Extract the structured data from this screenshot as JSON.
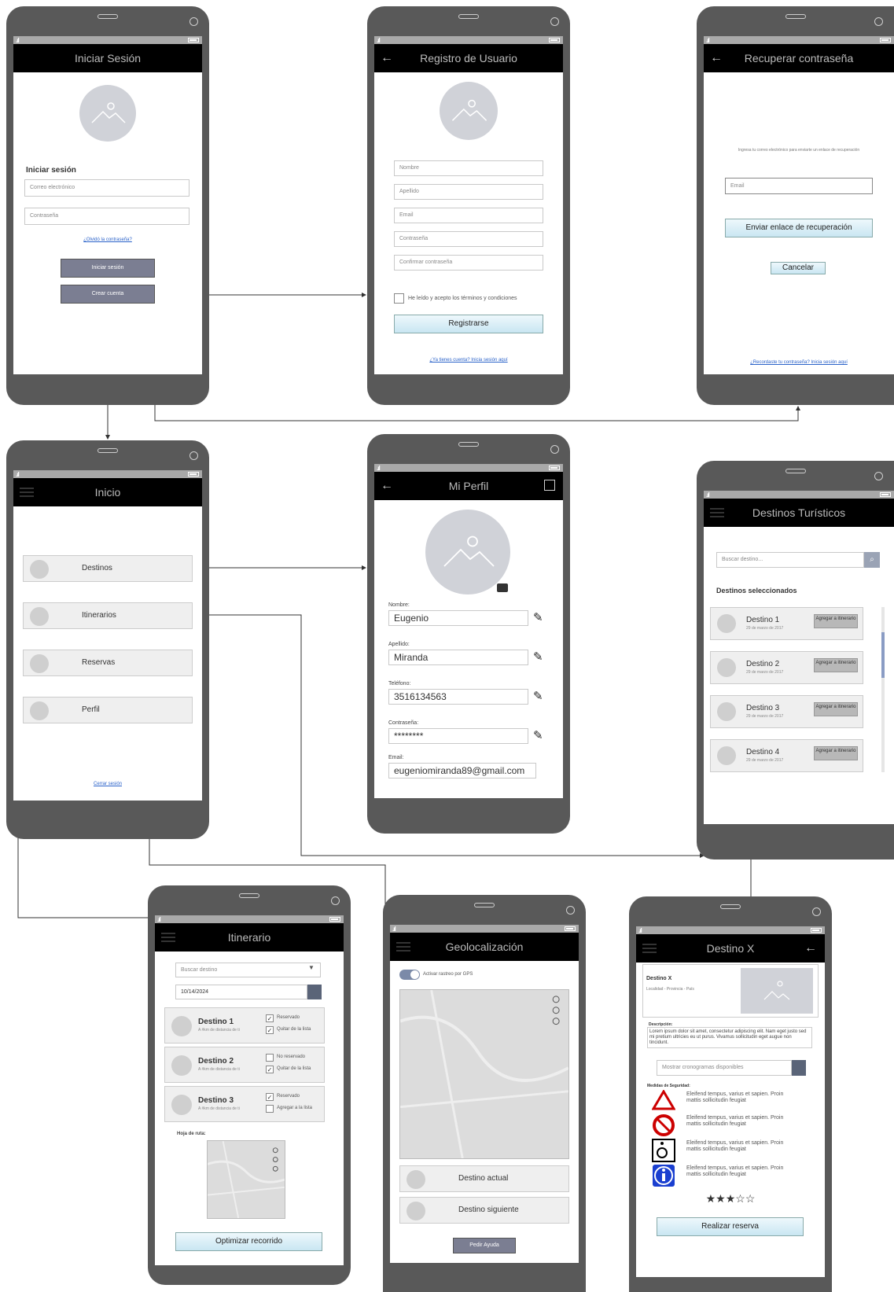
{
  "login": {
    "title": "Iniciar Sesión",
    "heading": "Iniciar sesión",
    "email_placeholder": "Correo electrónico",
    "password_placeholder": "Contraseña",
    "forgot_link": "¿Olvidó la contraseña?",
    "login_button": "Iniciar sesión",
    "create_button": "Crear cuenta"
  },
  "register": {
    "title": "Registro de Usuario",
    "fields": [
      "Nombre",
      "Apellido",
      "Email",
      "Contraseña",
      "Confirmar contraseña"
    ],
    "terms": "He leído y acepto los términos y condiciones",
    "submit": "Registrarse",
    "login_link": "¿Ya tienes cuenta? Inicia sesión aquí"
  },
  "recover": {
    "title": "Recuperar contraseña",
    "instructions": "Ingresa tu correo electrónico para enviarte un enlace de recuperación",
    "email_placeholder": "Email",
    "send_button": "Enviar enlace de recuperación",
    "cancel_button": "Cancelar",
    "login_link": "¿Recordaste tu contraseña? Inicia sesión aquí"
  },
  "home": {
    "title": "Inicio",
    "items": [
      "Destinos",
      "Itinerarios",
      "Reservas",
      "Perfil"
    ],
    "logout": "Cerrar sesión"
  },
  "profile": {
    "title": "Mi Perfil",
    "fields": [
      {
        "label": "Nombre:",
        "value": "Eugenio"
      },
      {
        "label": "Apellido:",
        "value": "Miranda"
      },
      {
        "label": "Teléfono:",
        "value": "3516134563"
      },
      {
        "label": "Contraseña:",
        "value": "********"
      },
      {
        "label": "Email:",
        "value": "eugeniomiranda89@gmail.com"
      }
    ]
  },
  "destinations": {
    "title": "Destinos Turísticos",
    "search_placeholder": "Buscar destino...",
    "section": "Destinos seleccionados",
    "items": [
      {
        "name": "Destino 1",
        "date": "29 de marzo de 2017",
        "action": "Agregar a itinerario"
      },
      {
        "name": "Destino 2",
        "date": "29 de marzo de 2017",
        "action": "Agregar a itinerario"
      },
      {
        "name": "Destino 3",
        "date": "29 de marzo de 2017",
        "action": "Agregar a itinerario"
      },
      {
        "name": "Destino 4",
        "date": "29 de marzo de 2017",
        "action": "Agregar a itinerario"
      }
    ]
  },
  "itinerary": {
    "title": "Itinerario",
    "search_placeholder": "Buscar destino",
    "date": "10/14/2024",
    "items": [
      {
        "name": "Destino 1",
        "dist": "A #km de distancia de ti",
        "c1": "Reservado",
        "c1v": "✓",
        "c2": "Quitar de la lista",
        "c2v": "✓"
      },
      {
        "name": "Destino 2",
        "dist": "A #km de distancia de ti",
        "c1": "No reservado",
        "c1v": "",
        "c2": "Quitar de la lista",
        "c2v": "✓"
      },
      {
        "name": "Destino 3",
        "dist": "A #km de distancia de ti",
        "c1": "Reservado",
        "c1v": "✓",
        "c2": "Agregar a la lista",
        "c2v": ""
      }
    ],
    "route_label": "Hoja de ruta:",
    "optimize": "Optimizar recorrido"
  },
  "geo": {
    "title": "Geolocalización",
    "gps": "Activar rastreo por GPS",
    "current": "Destino actual",
    "next": "Destino siguiente",
    "help": "Pedir Ayuda"
  },
  "destx": {
    "title": "Destino X",
    "name": "Destino X",
    "location": "Localidad - Provincia - País",
    "desc_label": "Descripción:",
    "desc": "Lorem ipsum dolor sit amet, consectetur adipiscing elit. Nam eget justo sed mi pretium ultricies eu ut purus. Vivamus sollicitudin eget augue non tincidunt.",
    "schedule": "Mostrar cronogramas disponibles",
    "safety_label": "Medidas de Seguridad:",
    "safety": [
      "Eleifend tempus, varius et sapien. Proin mattis sollicitudin feugiat",
      "Eleifend tempus, varius et sapien. Proin mattis sollicitudin feugiat",
      "Eleifend tempus, varius et sapien. Proin mattis sollicitudin feugiat",
      "Eleifend tempus, varius et sapien. Proin mattis sollicitudin feugiat"
    ],
    "rating": "★★★☆☆",
    "reserve": "Realizar reserva"
  },
  "colors": {
    "phone": "#595959",
    "appbar": "#000000",
    "link": "#2a62c9",
    "dark_button": "#7b7e92"
  }
}
